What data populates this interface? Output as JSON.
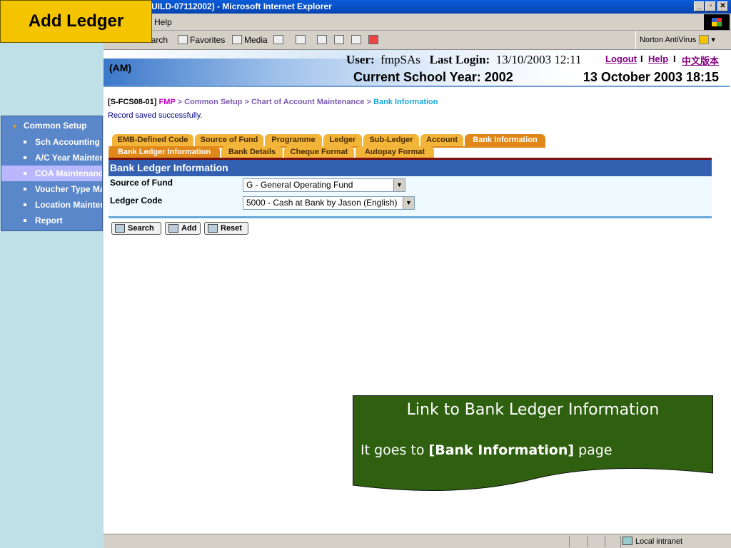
{
  "overlay_label": "Add Ledger",
  "window": {
    "title": "UILD-07112002) - Microsoft Internet Explorer",
    "menu_help": "Help",
    "toolbar": {
      "search": "earch",
      "favorites": "Favorites",
      "media": "Media"
    },
    "norton": "Norton AntiVirus"
  },
  "header": {
    "am": "(AM)",
    "user_label": "User:",
    "user": "fmpSAs",
    "last_login_label": "Last Login:",
    "last_login": "13/10/2003 12:11",
    "logout": "Logout",
    "help": "Help",
    "chinese": "中文版本",
    "school_year": "Current School Year: 2002",
    "datetime": "13 October 2003 18:15"
  },
  "sidebar": {
    "heading": "Common Setup",
    "items": [
      {
        "label": "Sch Accounting Period"
      },
      {
        "label": "A/C Year Maintenance"
      },
      {
        "label": "COA Maintenance"
      },
      {
        "label": "Voucher Type Maintenance"
      },
      {
        "label": "Location Maintenance"
      },
      {
        "label": "Report"
      }
    ]
  },
  "breadcrumb": {
    "code": "[S-FCS08-01]",
    "fmp": "FMP",
    "common": "Common Setup",
    "coa": "Chart of Account Maintenance",
    "current": "Bank Information",
    "sep": ">"
  },
  "message": "Record saved successfully.",
  "tabs_row1": [
    {
      "label": "EMB-Defined Code"
    },
    {
      "label": "Source of Fund"
    },
    {
      "label": "Programme"
    },
    {
      "label": "Ledger"
    },
    {
      "label": "Sub-Ledger"
    },
    {
      "label": "Account"
    },
    {
      "label": "Bank Information"
    }
  ],
  "tabs_row2": [
    {
      "label": "Bank Ledger Information"
    },
    {
      "label": "Bank Details"
    },
    {
      "label": "Cheque Format"
    },
    {
      "label": "Autopay Format"
    }
  ],
  "panel": {
    "title": "Bank Ledger Information",
    "source_label": "Source of Fund",
    "source_value": "G - General Operating Fund",
    "ledger_label": "Ledger Code",
    "ledger_value": "5000 - Cash at Bank by Jason (English)"
  },
  "buttons": {
    "search": "Search",
    "add": "Add",
    "reset": "Reset"
  },
  "callout": {
    "title": "Link to Bank Ledger Information",
    "body_prefix": "It goes to ",
    "body_bold": "[Bank Information]",
    "body_suffix": " page",
    "color": "#2e6010"
  },
  "statusbar": {
    "zone": "Local intranet"
  }
}
